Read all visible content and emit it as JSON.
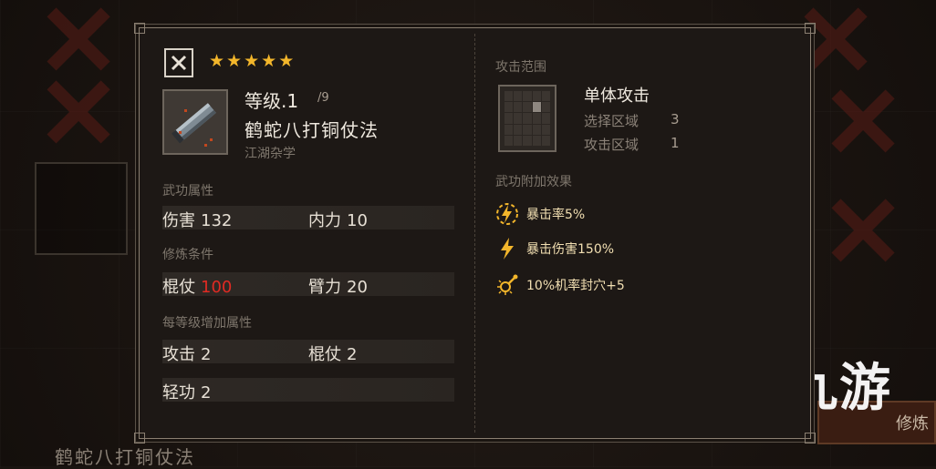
{
  "background": {
    "bottom_title": "鹤蛇八打铜仗法",
    "right_button_label": "修炼"
  },
  "watermark": {
    "text": "九游"
  },
  "panel": {
    "stars": 5,
    "level_label": "等级.1",
    "level_max": "/9",
    "item_name": "鹤蛇八打铜仗法",
    "item_category": "江湖杂学",
    "sections": {
      "attributes": {
        "title": "武功属性",
        "left": {
          "label": "伤害",
          "value": "132"
        },
        "right": {
          "label": "内力",
          "value": "10"
        }
      },
      "requirements": {
        "title": "修炼条件",
        "left": {
          "label": "棍仗",
          "value": "100"
        },
        "right": {
          "label": "臂力",
          "value": "20"
        }
      },
      "per_level": {
        "title": "每等级增加属性",
        "row1_left": {
          "label": "攻击",
          "value": "2"
        },
        "row1_right": {
          "label": "棍仗",
          "value": "2"
        },
        "row2_left": {
          "label": "轻功",
          "value": "2"
        }
      }
    },
    "attack_range": {
      "title": "攻击范围",
      "type": "单体攻击",
      "select_area_label": "选择区域",
      "select_area_value": "3",
      "attack_area_label": "攻击区域",
      "attack_area_value": "1"
    },
    "bonus_effects": {
      "title": "武功附加效果",
      "items": [
        {
          "icon": "crit-rate-icon",
          "text": "暴击率5%"
        },
        {
          "icon": "crit-damage-icon",
          "text": "暴击伤害150%"
        },
        {
          "icon": "acupoint-seal-icon",
          "text": "10%机率封穴+5"
        }
      ]
    }
  },
  "colors": {
    "star": "#f3b62b",
    "red_value": "#e02a23",
    "effect_text": "#f2dfb2"
  }
}
